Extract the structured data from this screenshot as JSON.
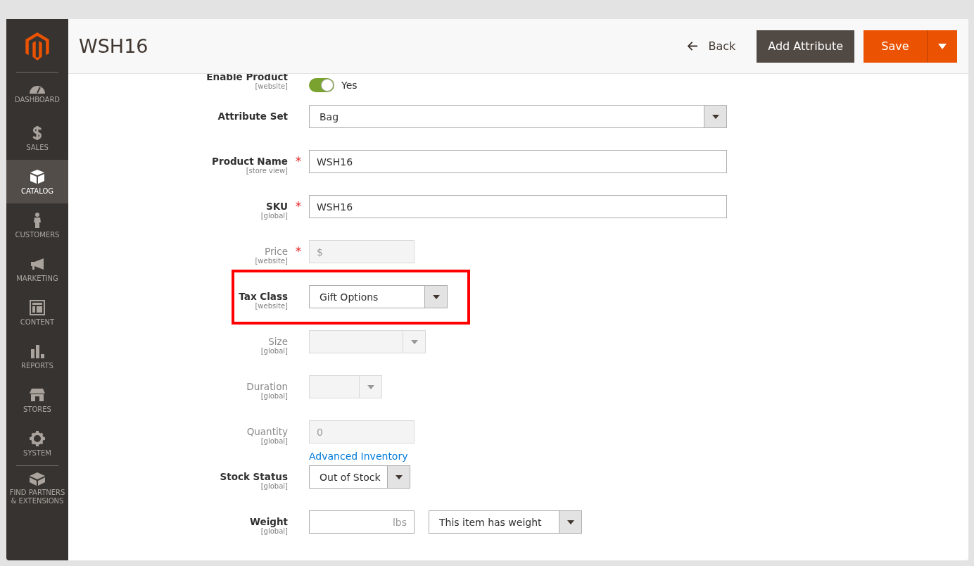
{
  "sidebar": {
    "items": [
      {
        "label": "DASHBOARD",
        "selected": false
      },
      {
        "label": "SALES",
        "selected": false
      },
      {
        "label": "CATALOG",
        "selected": true
      },
      {
        "label": "CUSTOMERS",
        "selected": false
      },
      {
        "label": "MARKETING",
        "selected": false
      },
      {
        "label": "CONTENT",
        "selected": false
      },
      {
        "label": "REPORTS",
        "selected": false
      },
      {
        "label": "STORES",
        "selected": false
      },
      {
        "label": "SYSTEM",
        "selected": false
      },
      {
        "label": "FIND PARTNERS & EXTENSIONS",
        "selected": false
      }
    ]
  },
  "header": {
    "title": "WSH16",
    "back": "Back",
    "add_attribute": "Add Attribute",
    "save": "Save"
  },
  "toggle_row": {
    "label": "Enable Product",
    "scope": "[website]",
    "on": true,
    "value": "Yes"
  },
  "fields": [
    {
      "kind": "select",
      "label": "Attribute Set",
      "disabled": false,
      "highlighted": false,
      "value": "Bag"
    },
    {
      "kind": "text",
      "label": "Product Name",
      "scope": "[store view]",
      "required_mark": "*",
      "disabled": false,
      "highlighted": false,
      "value": "WSH16"
    },
    {
      "kind": "text",
      "label": "SKU",
      "scope": "[global]",
      "required_mark": "*",
      "disabled": false,
      "highlighted": false,
      "value": "WSH16"
    },
    {
      "kind": "price",
      "label": "Price",
      "scope": "[website]",
      "required_mark": "*",
      "disabled": true,
      "highlighted": false,
      "prefix": "$"
    },
    {
      "kind": "select",
      "label": "Tax Class",
      "scope": "[website]",
      "disabled": false,
      "highlighted": true,
      "value": "Gift Options"
    },
    {
      "kind": "select",
      "label": "Size",
      "scope": "[global]",
      "disabled": true,
      "highlighted": false
    },
    {
      "kind": "select",
      "label": "Duration",
      "scope": "[global]",
      "disabled": true,
      "highlighted": false
    },
    {
      "kind": "text",
      "label": "Quantity",
      "scope": "[global]",
      "disabled": true,
      "highlighted": false,
      "value": "0",
      "link": "Advanced Inventory"
    },
    {
      "kind": "select",
      "label": "Stock Status",
      "scope": "[global]",
      "disabled": false,
      "highlighted": false,
      "value": "Out of Stock"
    },
    {
      "kind": "weight",
      "label": "Weight",
      "scope": "[global]",
      "disabled": false,
      "highlighted": false,
      "suffix": "lbs",
      "value": "This item has weight"
    }
  ]
}
